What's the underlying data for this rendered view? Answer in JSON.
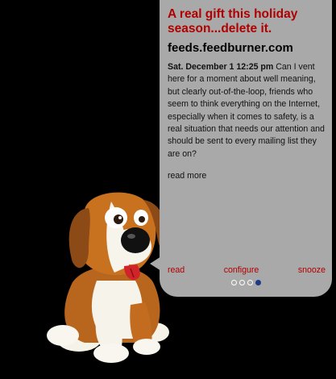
{
  "widget": {
    "headline": "A real gift this holiday season...delete it.",
    "feed_source": "feeds.feedburner.com",
    "date": "Sat. December 1 12:25 pm",
    "body": "Can I vent here for a moment about well meaning, but clearly out-of-the-loop, friends who seem to think everything on the Internet, especially when it comes to safety, is a real situation that needs our attention and should be sent to every mailing list they are on?",
    "read_more": "read more",
    "actions": {
      "read": "read",
      "configure": "configure",
      "snooze": "snooze"
    },
    "pager": {
      "total": 4,
      "current": 4
    }
  },
  "colors": {
    "background": "#000000",
    "bubble": "#a9a9a9",
    "accent_red": "#b00000",
    "active_dot": "#1c3a88"
  },
  "mascot": {
    "icon": "cartoon-beagle-dog"
  }
}
